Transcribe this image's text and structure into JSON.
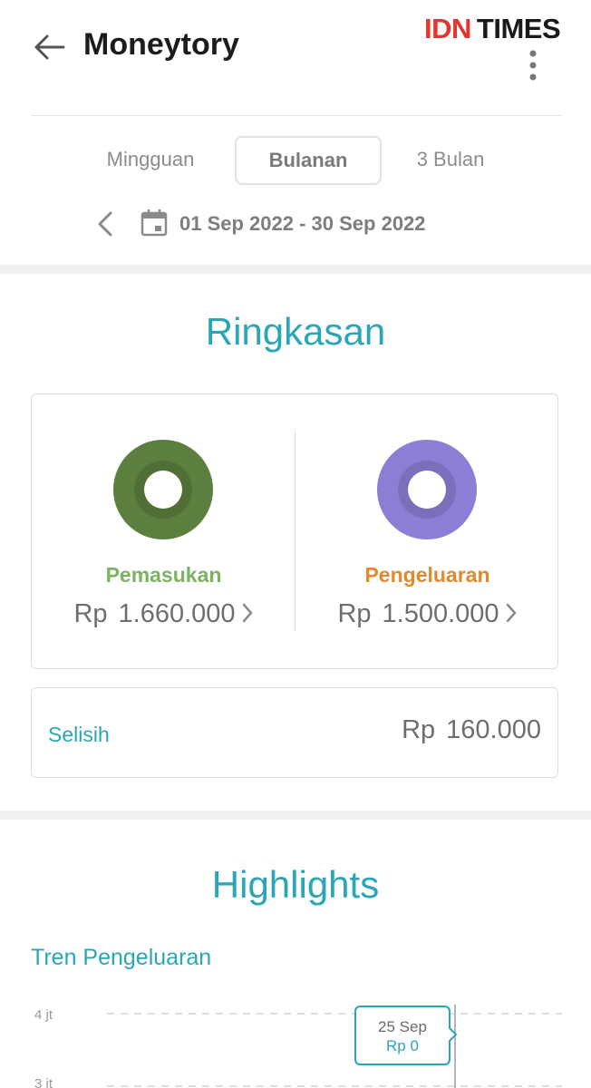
{
  "header": {
    "title": "Moneytory",
    "back_icon": "arrow-left-icon",
    "more_icon": "more-vertical-icon"
  },
  "watermark": {
    "part1": "IDN",
    "part2": "TIMES"
  },
  "period_tabs": [
    {
      "label": "Mingguan",
      "selected": false
    },
    {
      "label": "Bulanan",
      "selected": true
    },
    {
      "label": "3 Bulan",
      "selected": false
    }
  ],
  "date_range": {
    "text": "01 Sep 2022 - 30 Sep 2022",
    "prev_icon": "chevron-left-icon",
    "calendar_icon": "calendar-icon"
  },
  "summary": {
    "title": "Ringkasan",
    "income": {
      "label": "Pemasukan",
      "currency": "Rp",
      "amount": "1.660.000",
      "color": "#5a7f3e",
      "label_color": "#7ab460"
    },
    "expense": {
      "label": "Pengeluaran",
      "currency": "Rp",
      "amount": "1.500.000",
      "color": "#8a7fd4",
      "label_color": "#e08a2e"
    },
    "difference": {
      "label": "Selisih",
      "currency": "Rp",
      "amount": "160.000"
    }
  },
  "highlights": {
    "title": "Highlights",
    "chart_title": "Tren Pengeluaran",
    "tooltip": {
      "date": "25 Sep",
      "value": "Rp 0"
    }
  },
  "colors": {
    "accent": "#2aa6b9",
    "income": "#5a7f3e",
    "expense": "#8a7fd4"
  },
  "chart_data": {
    "type": "line",
    "title": "Tren Pengeluaran",
    "y_ticks": [
      "4 jt",
      "3 jt"
    ],
    "visible_y_range": [
      3000000,
      4000000
    ],
    "grid": true,
    "selected_point": {
      "x": "25 Sep",
      "y": 0
    }
  }
}
